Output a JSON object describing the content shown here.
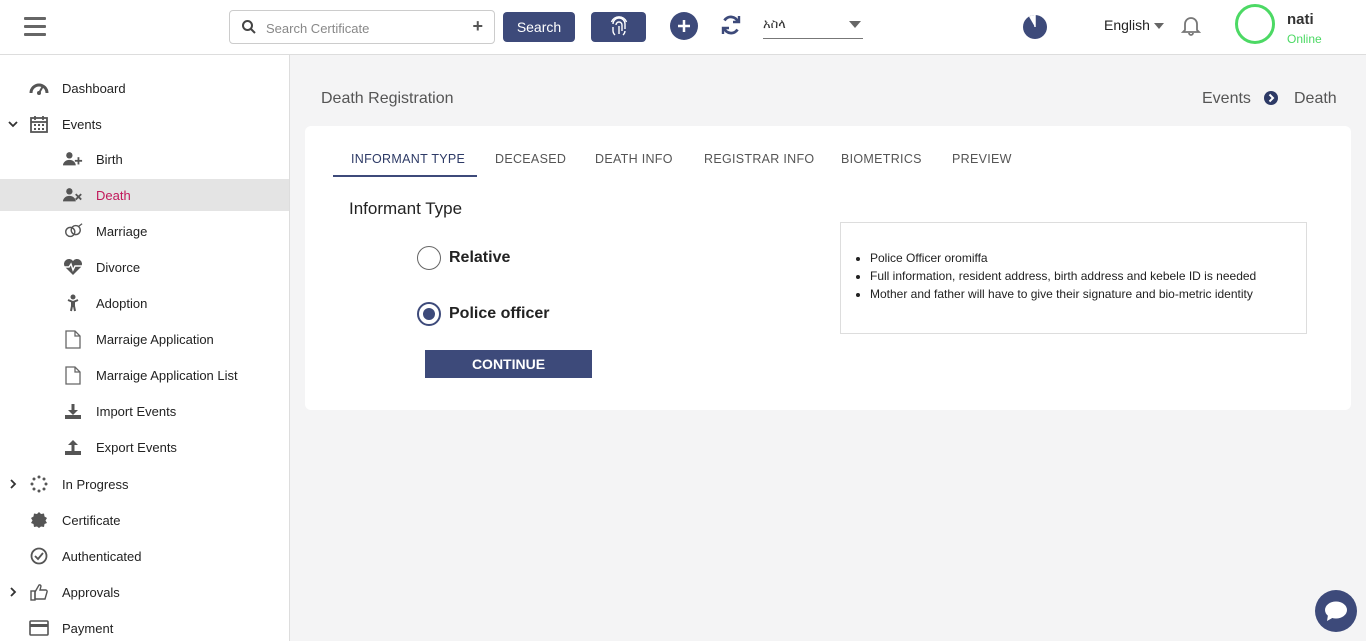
{
  "topbar": {
    "search_placeholder": "Search Certificate",
    "search_label": "Search",
    "select_value": "አስላ",
    "language": "English",
    "user_name": "nati",
    "user_status": "Online"
  },
  "sidebar": {
    "dashboard": "Dashboard",
    "events": "Events",
    "birth": "Birth",
    "death": "Death",
    "marriage": "Marriage",
    "divorce": "Divorce",
    "adoption": "Adoption",
    "marriage_application": "Marraige Application",
    "marriage_application_list": "Marraige Application List",
    "import_events": "Import Events",
    "export_events": "Export Events",
    "in_progress": "In Progress",
    "certificate": "Certificate",
    "authenticated": "Authenticated",
    "approvals": "Approvals",
    "payment": "Payment"
  },
  "header": {
    "title": "Death Registration",
    "breadcrumb": [
      "Events",
      "Death"
    ]
  },
  "tabs": [
    "INFORMANT TYPE",
    "DECEASED",
    "DEATH INFO",
    "REGISTRAR INFO",
    "BIOMETRICS",
    "PREVIEW"
  ],
  "form": {
    "section_title": "Informant Type",
    "options": [
      "Relative",
      "Police officer"
    ],
    "selected": "Police officer",
    "continue_label": "CONTINUE"
  },
  "info": [
    "Police Officer oromiffa",
    "Full information, resident address, birth address and kebele ID is needed",
    "Mother and father will have to give their signature and bio-metric identity"
  ],
  "colors": {
    "primary": "#3d4a7a",
    "active_nav_text": "#c2185b",
    "online": "#4cd964"
  }
}
